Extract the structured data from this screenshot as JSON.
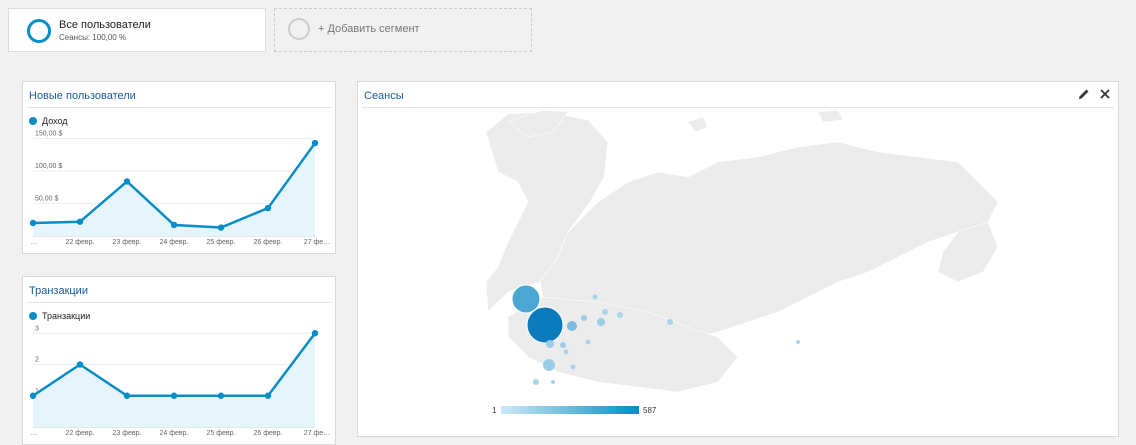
{
  "segments": {
    "all_users": {
      "title": "Все пользователи",
      "subtitle": "Сеансы: 100,00 %"
    },
    "add": {
      "label": "+ Добавить сегмент"
    }
  },
  "colors": {
    "accent": "#058dc7",
    "area": "#e6f4fb",
    "segment_ring_inactive": "#cccccc"
  },
  "cards": {
    "new_users": {
      "title": "Новые пользователи",
      "legend": "Доход"
    },
    "transactions": {
      "title": "Транзакции",
      "legend": "Транзакции"
    },
    "sessions": {
      "title": "Сеансы",
      "edit_icon": "pencil-icon",
      "close_icon": "close-icon"
    }
  },
  "chart_data": [
    {
      "type": "line",
      "title": "Новые пользователи",
      "series": [
        {
          "name": "Доход",
          "values": [
            20,
            22,
            84,
            17,
            13,
            43,
            143
          ]
        }
      ],
      "categories": [
        "…",
        "22 февр.",
        "23 февр.",
        "24 февр.",
        "25 февр.",
        "26 февр.",
        "27 фе…"
      ],
      "yticks": [
        {
          "value": 50,
          "label": "50,00 $"
        },
        {
          "value": 100,
          "label": "100,00 $"
        },
        {
          "value": 150,
          "label": "150,00 $"
        }
      ],
      "ylim": [
        0,
        160
      ],
      "grid": true
    },
    {
      "type": "line",
      "title": "Транзакции",
      "series": [
        {
          "name": "Транзакции",
          "values": [
            1,
            2,
            1,
            1,
            1,
            1,
            3
          ]
        }
      ],
      "categories": [
        "…",
        "22 февр.",
        "23 февр.",
        "24 февр.",
        "25 февр.",
        "26 февр.",
        "27 фе…"
      ],
      "yticks": [
        {
          "value": 1,
          "label": "1"
        },
        {
          "value": 2,
          "label": "2"
        },
        {
          "value": 3,
          "label": "3"
        }
      ],
      "ylim": [
        0,
        3.2
      ],
      "grid": true
    }
  ],
  "map": {
    "scale_min": "1",
    "scale_max": "587"
  }
}
